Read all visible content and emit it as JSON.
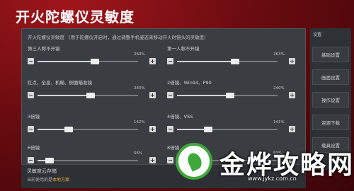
{
  "title": "开火陀螺仪灵敏度",
  "description": "开火陀螺仪灵敏度  （用于陀螺仪开启时，通过调整手机姿态来移动开火时镜头的灵敏度）",
  "sliders": [
    {
      "label": "第三人称不开镜",
      "percent": "260%",
      "level": 0.57
    },
    {
      "label": "第一人称不开镜",
      "percent": "263%",
      "level": 0.58
    },
    {
      "label": "红点、全息、机瞄、侧面瞄准镜",
      "percent": "240%",
      "level": 0.53
    },
    {
      "label": "2倍镜、Win94、P90",
      "percent": "240%",
      "level": 0.53
    },
    {
      "label": "3倍镜",
      "percent": "142%",
      "level": 0.31
    },
    {
      "label": "4倍镜、VSS",
      "percent": "141%",
      "level": 0.31
    },
    {
      "label": "6倍镜",
      "percent": "56%",
      "level": 0.12
    },
    {
      "label": "8倍镜",
      "percent": "53%",
      "level": 0.11
    }
  ],
  "sidebar": {
    "top_label": "设置",
    "items": [
      {
        "label": "基础设置",
        "active": false
      },
      {
        "label": "画面设置",
        "active": false
      },
      {
        "label": "操作设置",
        "active": false
      },
      {
        "label": "资源下载",
        "active": false
      },
      {
        "label": "载具设置",
        "active": false
      }
    ]
  },
  "storage": {
    "title": "灵敏度云存储",
    "subtitle": "当前使用的是",
    "highlight": "本地方案"
  },
  "watermark": {
    "text": "金烨攻略网",
    "url": "www.jykz.com.cn"
  }
}
